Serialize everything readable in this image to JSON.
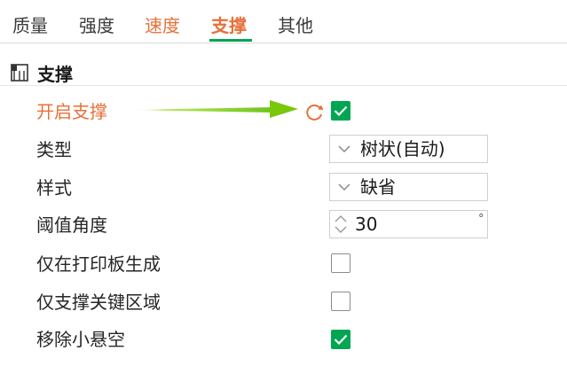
{
  "tabs": [
    {
      "label": "质量"
    },
    {
      "label": "强度"
    },
    {
      "label": "速度"
    },
    {
      "label": "支撑"
    },
    {
      "label": "其他"
    }
  ],
  "section": {
    "title": "支撑",
    "icon": "support-section-icon"
  },
  "settings": {
    "enable_support": {
      "label": "开启支撑",
      "checked": true
    },
    "type": {
      "label": "类型",
      "value": "树状(自动)"
    },
    "style": {
      "label": "样式",
      "value": "缺省"
    },
    "threshold_angle": {
      "label": "阈值角度",
      "value": "30",
      "unit": "°"
    },
    "build_plate_only": {
      "label": "仅在打印板生成",
      "checked": false
    },
    "critical_regions_only": {
      "label": "仅支撑关键区域",
      "checked": false
    },
    "remove_small_overhangs": {
      "label": "移除小悬空",
      "checked": true
    }
  },
  "colors": {
    "accent": "#00a651",
    "highlight": "#e8703a",
    "arrow": "#7ac70c"
  }
}
